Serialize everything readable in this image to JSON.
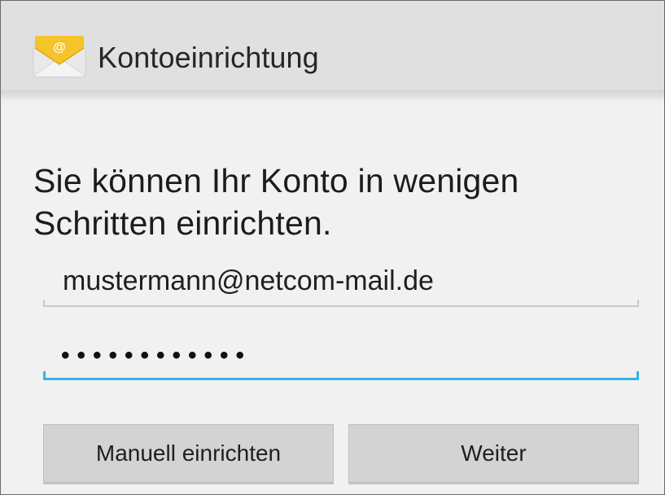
{
  "action_bar": {
    "title": "Kontoeinrichtung",
    "icon": "email-envelope-icon",
    "icon_symbol": "@"
  },
  "main": {
    "intro_text": "Sie können Ihr Konto in wenigen Schritten einrichten.",
    "email_field": {
      "value": "mustermann@netcom-mail.de"
    },
    "password_field": {
      "masked_value": "••••••••••••",
      "focused": true
    }
  },
  "buttons": {
    "manual_setup_label": "Manuell einrichten",
    "next_label": "Weiter"
  },
  "colors": {
    "focus_accent": "#33b5e5",
    "action_bar_bg": "#e0e0e0",
    "page_bg": "#f1f1f1",
    "button_bg": "#d3d3d3",
    "icon_envelope": "#f0f0f0",
    "icon_flap": "#f5c32a"
  }
}
